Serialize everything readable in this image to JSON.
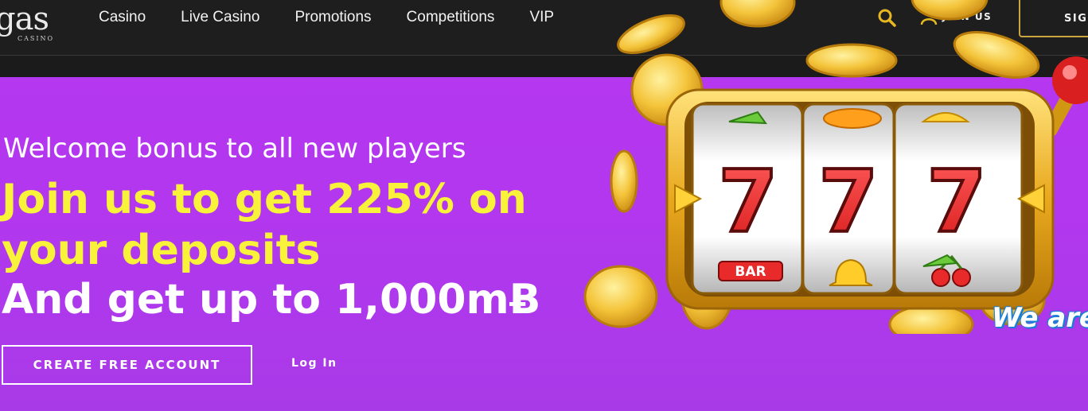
{
  "header": {
    "logo_main": "gas",
    "logo_sub": "CASINO",
    "nav": [
      "Casino",
      "Live Casino",
      "Promotions",
      "Competitions",
      "VIP"
    ],
    "search_icon": "search-icon",
    "join_label": "JOIN US",
    "join_icon": "user-icon",
    "sign_label": "SIGI",
    "accent_color": "#e8b820"
  },
  "hero": {
    "subtitle": "Welcome bonus to all new players",
    "title": "Join us to get 225% on your deposits",
    "amount": "And get up to 1,000mɃ",
    "cta_label": "CREATE FREE ACCOUNT",
    "login_label": "Log In",
    "badge_text": "We are",
    "background": "#b237ee",
    "title_color": "#f8f33a",
    "reels": [
      "7",
      "7",
      "7"
    ],
    "reel_top_symbols": [
      "cherry-icon",
      "orange-icon",
      "lemon-icon"
    ],
    "reel_bottom_symbols": [
      "BAR",
      "bell-icon",
      "cherry-icon"
    ]
  }
}
